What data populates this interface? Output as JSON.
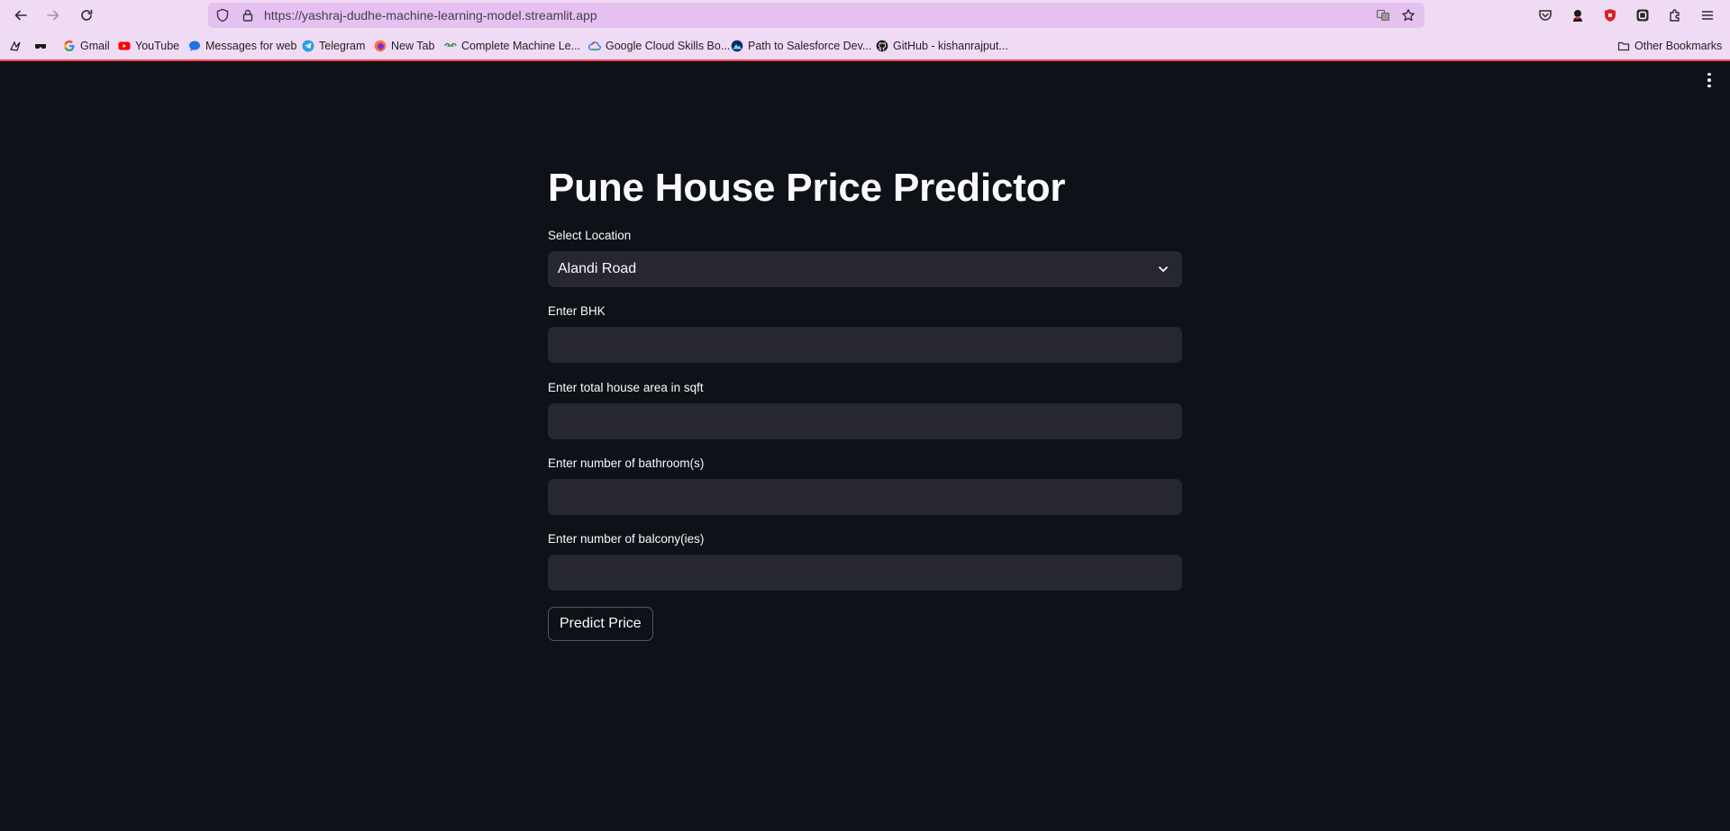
{
  "browser": {
    "url": "https://yashraj-dudhe-machine-learning-model.streamlit.app",
    "bookmarks": [
      {
        "label": ""
      },
      {
        "label": ""
      },
      {
        "label": "Gmail"
      },
      {
        "label": "YouTube"
      },
      {
        "label": "Messages for web"
      },
      {
        "label": "Telegram"
      },
      {
        "label": "New Tab"
      },
      {
        "label": "Complete Machine Le..."
      },
      {
        "label": "Google Cloud Skills Bo..."
      },
      {
        "label": "Path to Salesforce Dev..."
      },
      {
        "label": "GitHub - kishanrajput..."
      }
    ],
    "other_bookmarks": "Other Bookmarks"
  },
  "app": {
    "title": "Pune House Price Predictor",
    "location": {
      "label": "Select Location",
      "value": "Alandi Road"
    },
    "bhk": {
      "label": "Enter BHK",
      "value": ""
    },
    "area": {
      "label": "Enter total house area in sqft",
      "value": ""
    },
    "bathrooms": {
      "label": "Enter number of bathroom(s)",
      "value": ""
    },
    "balconies": {
      "label": "Enter number of balcony(ies)",
      "value": ""
    },
    "predict_button": "Predict Price"
  },
  "colors": {
    "background": "#0e1117",
    "input_bg": "#262730",
    "text": "#fafafa",
    "accent": "#ff4b4b",
    "browser_chrome": "#f0dbf5",
    "url_bar": "#e5c1f0"
  }
}
